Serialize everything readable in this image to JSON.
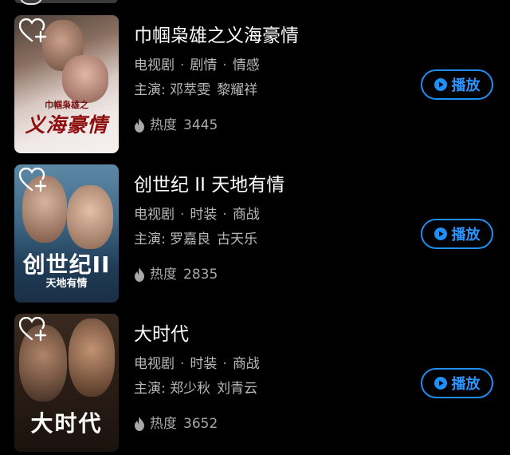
{
  "list": [
    {
      "title": "巾帼枭雄之义海豪情",
      "tags": [
        "电视剧",
        "剧情",
        "情感"
      ],
      "cast_label": "主演:",
      "cast": [
        "邓萃雯",
        "黎耀祥"
      ],
      "heat_label": "热度",
      "heat": "3445",
      "play_label": "播放",
      "poster_text": "义海豪情",
      "poster_sub": "巾帼枭雄之"
    },
    {
      "title": "创世纪 II 天地有情",
      "tags": [
        "电视剧",
        "时装",
        "商战"
      ],
      "cast_label": "主演:",
      "cast": [
        "罗嘉良",
        "古天乐"
      ],
      "heat_label": "热度",
      "heat": "2835",
      "play_label": "播放",
      "poster_text": "创世纪II",
      "poster_sub": "天地有情"
    },
    {
      "title": "大时代",
      "tags": [
        "电视剧",
        "时装",
        "商战"
      ],
      "cast_label": "主演:",
      "cast": [
        "郑少秋",
        "刘青云"
      ],
      "heat_label": "热度",
      "heat": "3652",
      "play_label": "播放",
      "poster_text": "大时代"
    }
  ],
  "icons": {
    "favorite": "heart-plus-icon",
    "heat": "flame-icon",
    "play": "play-circle-icon"
  },
  "colors": {
    "background": "#000000",
    "accent": "#1f8ef5",
    "title": "#ffffff",
    "secondary": "#b9b9b9"
  }
}
